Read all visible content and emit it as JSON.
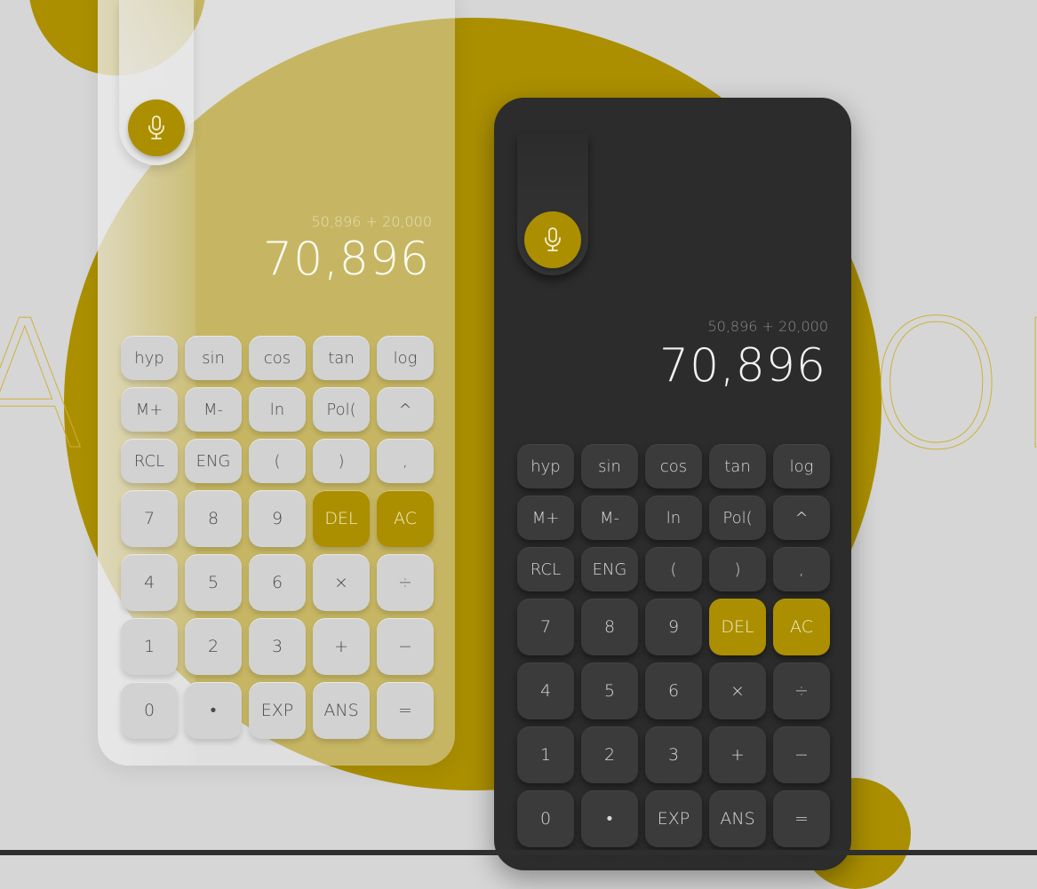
{
  "colors": {
    "accent": "#ab8f00",
    "background": "#d6d6d6",
    "dark_body": "#2c2c2c"
  },
  "background_text": {
    "left": "A",
    "right": "OR"
  },
  "light_calc": {
    "expression": "50,896 + 20,000",
    "result": "70,896",
    "mic_icon": "microphone-icon"
  },
  "dark_calc": {
    "expression": "50,896 + 20,000",
    "result": "70,896",
    "mic_icon": "microphone-icon"
  },
  "keys": [
    [
      "hyp",
      "sin",
      "cos",
      "tan",
      "log"
    ],
    [
      "M+",
      "M-",
      "ln",
      "Pol(",
      "^"
    ],
    [
      "RCL",
      "ENG",
      "(",
      ")",
      ","
    ],
    [
      "7",
      "8",
      "9",
      "DEL",
      "AC"
    ],
    [
      "4",
      "5",
      "6",
      "×",
      "÷"
    ],
    [
      "1",
      "2",
      "3",
      "+",
      "−"
    ],
    [
      "0",
      "•",
      "EXP",
      "ANS",
      "="
    ]
  ]
}
